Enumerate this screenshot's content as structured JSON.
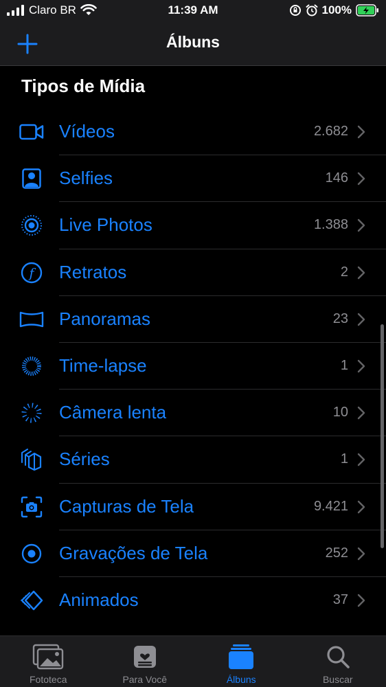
{
  "status_bar": {
    "carrier": "Claro BR",
    "time": "11:39 AM",
    "battery": "100%"
  },
  "nav": {
    "title": "Álbuns",
    "add_icon": "plus-icon"
  },
  "section": {
    "title": "Tipos de Mídia"
  },
  "media_types": [
    {
      "label": "Vídeos",
      "count": "2.682",
      "icon": "video-icon"
    },
    {
      "label": "Selfies",
      "count": "146",
      "icon": "selfie-icon"
    },
    {
      "label": "Live Photos",
      "count": "1.388",
      "icon": "live-photo-icon"
    },
    {
      "label": "Retratos",
      "count": "2",
      "icon": "portrait-icon"
    },
    {
      "label": "Panoramas",
      "count": "23",
      "icon": "panorama-icon"
    },
    {
      "label": "Time-lapse",
      "count": "1",
      "icon": "time-lapse-icon"
    },
    {
      "label": "Câmera lenta",
      "count": "10",
      "icon": "slow-motion-icon"
    },
    {
      "label": "Séries",
      "count": "1",
      "icon": "burst-icon"
    },
    {
      "label": "Capturas de Tela",
      "count": "9.421",
      "icon": "screenshot-icon"
    },
    {
      "label": "Gravações de Tela",
      "count": "252",
      "icon": "screen-recording-icon"
    },
    {
      "label": "Animados",
      "count": "37",
      "icon": "animated-icon"
    }
  ],
  "tabs": [
    {
      "label": "Fototeca",
      "icon": "photos-library-icon",
      "active": false
    },
    {
      "label": "Para Você",
      "icon": "for-you-icon",
      "active": false
    },
    {
      "label": "Álbuns",
      "icon": "albums-icon",
      "active": true
    },
    {
      "label": "Buscar",
      "icon": "search-icon",
      "active": false
    }
  ],
  "colors": {
    "accent": "#1a82ff",
    "background": "#000000",
    "bar": "#1c1c1e",
    "secondary_text": "#8e8e93",
    "battery_fill": "#30d158"
  }
}
